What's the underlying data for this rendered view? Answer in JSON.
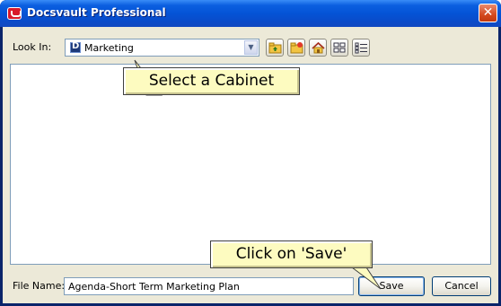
{
  "window": {
    "title": "Docsvault Professional",
    "close_glyph": "✕"
  },
  "look_in": {
    "label": "Look In:",
    "value": "Marketing",
    "icon": "cabinet-icon",
    "dropdown_glyph": "▼"
  },
  "toolbar": {
    "buttons": [
      "up-one-level-icon",
      "new-folder-icon",
      "home-icon",
      "list-view-icon",
      "details-view-icon"
    ]
  },
  "file_name": {
    "label": "File Name:",
    "value": "Agenda-Short Term Marketing Plan"
  },
  "buttons": {
    "save": "Save",
    "cancel": "Cancel"
  },
  "callouts": {
    "cabinet": "Select a Cabinet",
    "save": "Click on 'Save'"
  },
  "colors": {
    "titlebar": "#0453d6",
    "client": "#ece9d8",
    "callout": "#fdfbc0",
    "close_button": "#d44a1f"
  }
}
